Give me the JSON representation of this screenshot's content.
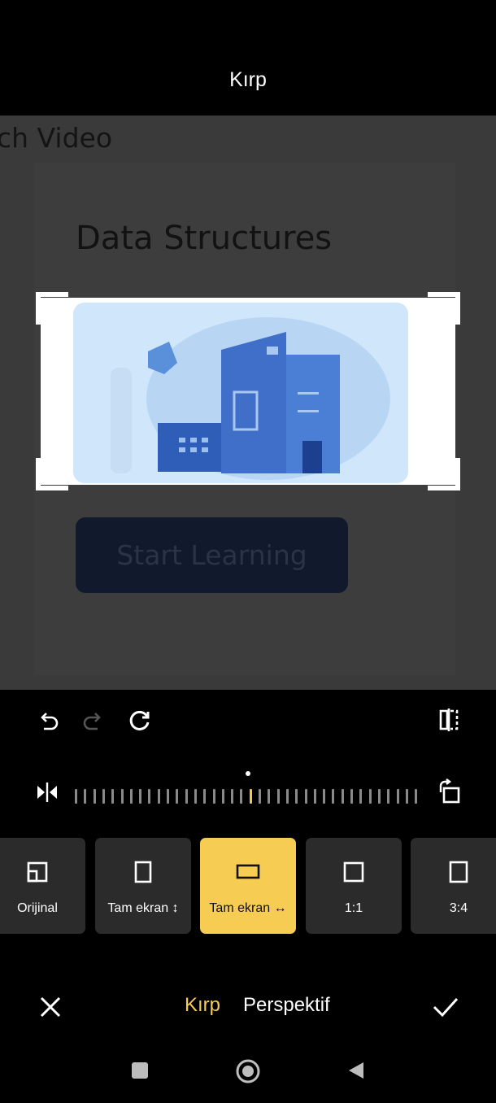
{
  "header": {
    "title": "Kırp"
  },
  "background": {
    "heading_fragment": "ch Video",
    "course_title": "Data Structures",
    "button_label": "Start Learning"
  },
  "toolbar": {
    "undo_icon": "undo-icon",
    "redo_icon": "redo-icon",
    "reset_icon": "reset-icon",
    "flip_icon": "flip-horizontal-icon",
    "mirror_icon": "mirror-icon",
    "rotate_icon": "rotate-icon"
  },
  "ratios": [
    {
      "label": "Orijinal",
      "active": false
    },
    {
      "label": "Tam ekran ↕",
      "active": false
    },
    {
      "label": "Tam ekran ↔",
      "active": true
    },
    {
      "label": "1:1",
      "active": false
    },
    {
      "label": "3:4",
      "active": false
    }
  ],
  "bottom": {
    "tabs": [
      {
        "label": "Kırp",
        "active": true
      },
      {
        "label": "Perspektif",
        "active": false
      }
    ]
  },
  "colors": {
    "accent": "#f6cc52",
    "background": "#000000",
    "chip": "#2b2b2b"
  }
}
